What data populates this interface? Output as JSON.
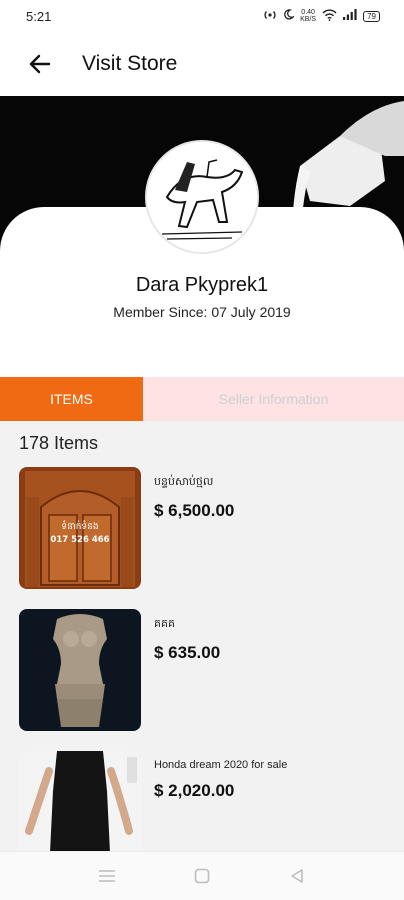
{
  "status_bar": {
    "time": "5:21",
    "net_speed_value": "0.40",
    "net_speed_unit": "KB/S",
    "battery": "79",
    "icons": [
      "hotspot-icon",
      "moon-icon",
      "wifi-icon",
      "signal-icon",
      "battery-icon"
    ]
  },
  "app_bar": {
    "back_icon": "arrow-left-icon",
    "title": "Visit Store"
  },
  "store": {
    "name": "Dara Pkyprek1",
    "member_since": "Member Since: 07 July 2019"
  },
  "tabs": [
    {
      "label": "ITEMS",
      "active": true,
      "color": "#ef6a12"
    },
    {
      "label": "Seller Information",
      "active": false,
      "color": "#fde3e3"
    }
  ],
  "items_count": "178 Items",
  "products": [
    {
      "name": "បន្ទប់សាប់ថ្មល",
      "price": "$ 6,500.00",
      "image_text_1": "ទំនាក់ទំនង",
      "image_text_2": "017 526 466"
    },
    {
      "name": "គគគ",
      "price": "$ 635.00"
    },
    {
      "name": "Honda dream 2020 for sale",
      "price": "$ 2,020.00"
    }
  ],
  "nav_bar": {
    "icons": [
      "menu-icon",
      "home-square-icon",
      "back-triangle-icon"
    ]
  },
  "colors": {
    "accent": "#ef6a12",
    "tab_inactive_bg": "#fde3e3",
    "list_bg": "#f2f2f2"
  }
}
